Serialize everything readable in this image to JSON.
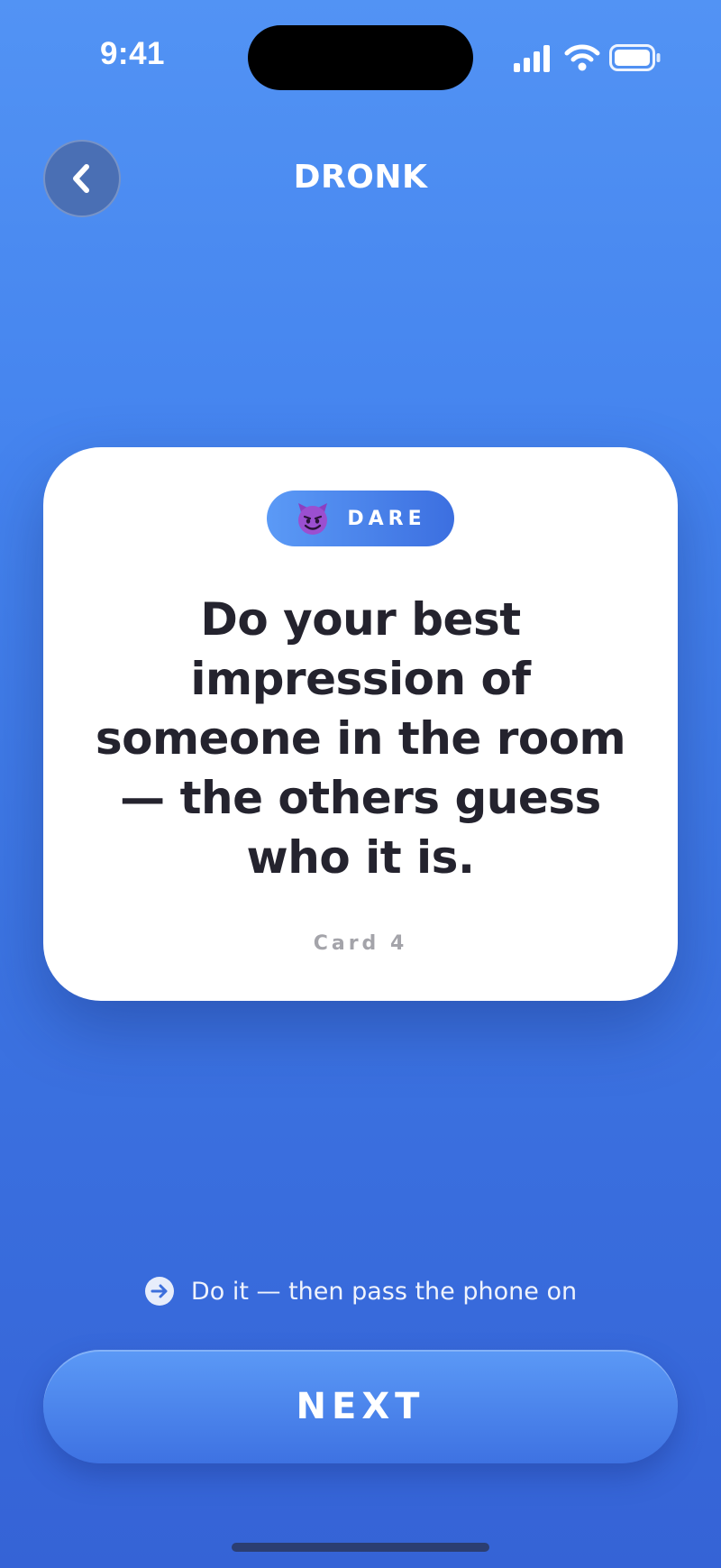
{
  "status_bar": {
    "time": "9:41",
    "icons": [
      "cellular-signal-icon",
      "wifi-icon",
      "battery-icon"
    ]
  },
  "header": {
    "back_icon": "chevron-left-icon",
    "title": "DRONK"
  },
  "card": {
    "category_emoji": "smiling-devil-icon",
    "category_label": "DARE",
    "prompt": "Do your best impression of someone in the room — the others guess who it is.",
    "card_number": "Card 4"
  },
  "hint": {
    "icon": "arrow-right-circle-icon",
    "text": "Do it — then pass the phone on"
  },
  "next_button": {
    "label": "NEXT"
  },
  "colors": {
    "background_top": "#5293f4",
    "background_bottom": "#3563d6",
    "card_background": "#ffffff",
    "prompt_text": "#24232e",
    "muted_text": "#a4a4aa",
    "accent": "#4a80ec"
  }
}
